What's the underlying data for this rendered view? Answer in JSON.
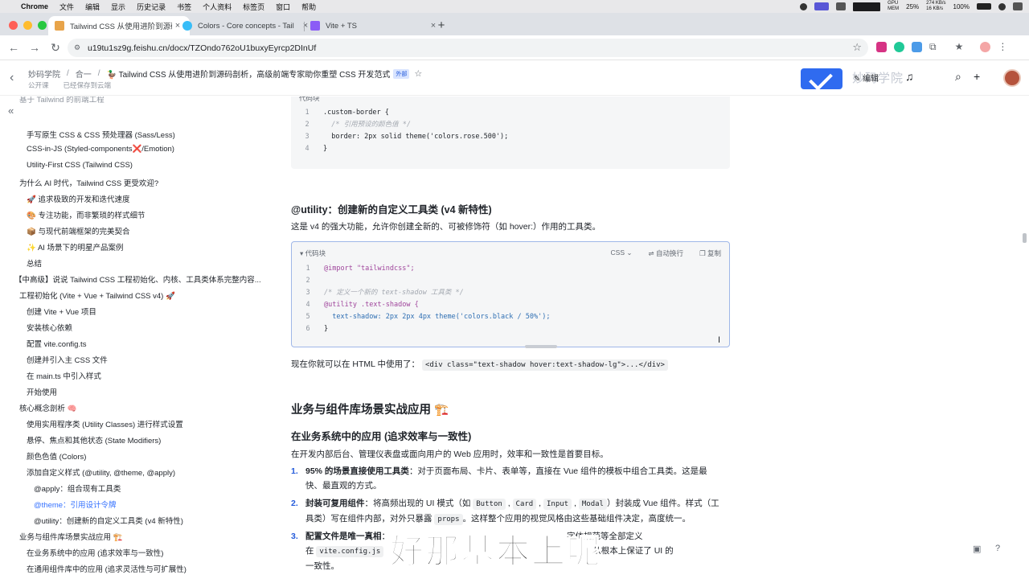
{
  "menubar": {
    "app": "Chrome",
    "items": [
      "文件",
      "编辑",
      "显示",
      "历史记录",
      "书签",
      "个人资料",
      "标签页",
      "窗口",
      "帮助"
    ],
    "stats": {
      "gpu": "GPU",
      "mem": "MEM",
      "cpu_val": "25%",
      "net_up": "274 KB/s",
      "net_down": "16 KB/s",
      "battery": "100%"
    }
  },
  "tabs": [
    {
      "title": "Tailwind CSS 从使用进阶到源码",
      "active": true,
      "color": "#e8a44a"
    },
    {
      "title": "Colors - Core concepts - Tail",
      "active": false,
      "color": "#38bdf8"
    },
    {
      "title": "Vite + TS",
      "active": false,
      "color": "#8b5cf6"
    }
  ],
  "address": {
    "url": "u19tu1sz9g.feishu.cn/docx/TZOndo762oU1buxyEyrcp2DInUf"
  },
  "doc_header": {
    "crumb_root": "妙码学院",
    "crumb_mid": "合一",
    "title": "🦆 Tailwind CSS 从使用进阶到源码剖析，高级前端专家助你重塑 CSS 开发范式",
    "tag": "外部",
    "visibility": "公开课",
    "save_status": "已经保存到云端",
    "edit_label": "编辑",
    "watermark": "妙码学院"
  },
  "sidebar": {
    "cut_top": "基于 Tailwind 的前端工程",
    "items": [
      {
        "text": "手写原生 CSS & CSS 预处理器 (Sass/Less)",
        "level": 2
      },
      {
        "text": "CSS-in-JS (Styled-components❌/Emotion)",
        "level": 2
      },
      {
        "text": "Utility-First CSS (Tailwind CSS)",
        "level": 2
      },
      {
        "text": "为什么 AI 时代，Tailwind CSS 更受欢迎?",
        "level": 1
      },
      {
        "text": "🚀 追求极致的开发和迭代速度",
        "level": 2
      },
      {
        "text": "🎨 专注功能，而非繁琐的样式细节",
        "level": 2
      },
      {
        "text": "📦 与现代前端框架的完美契合",
        "level": 2
      },
      {
        "text": "✨ AI 场景下的明星产品案例",
        "level": 2
      },
      {
        "text": "总结",
        "level": 2
      },
      {
        "text": "【中高级】说说 Tailwind CSS 工程初始化、内核、工具类体系完整内容...",
        "level": 0
      },
      {
        "text": "工程初始化 (Vite + Vue + Tailwind CSS v4) 🚀",
        "level": 1
      },
      {
        "text": "创建 Vite + Vue 项目",
        "level": 2
      },
      {
        "text": "安装核心依赖",
        "level": 2
      },
      {
        "text": "配置 vite.config.ts",
        "level": 2
      },
      {
        "text": "创建并引入主 CSS 文件",
        "level": 2
      },
      {
        "text": "在 main.ts 中引入样式",
        "level": 2
      },
      {
        "text": "开始使用",
        "level": 2
      },
      {
        "text": "核心概念剖析 🧠",
        "level": 1
      },
      {
        "text": "使用实用程序类 (Utility Classes) 进行样式设置",
        "level": 2
      },
      {
        "text": "悬停、焦点和其他状态 (State Modifiers)",
        "level": 2
      },
      {
        "text": "颜色色值 (Colors)",
        "level": 2
      },
      {
        "text": "添加自定义样式 (@utility, @theme, @apply)",
        "level": 2
      },
      {
        "text": "@apply：组合现有工具类",
        "level": 3
      },
      {
        "text": "@theme：引用设计令牌",
        "level": 3,
        "active": true
      },
      {
        "text": "@utility：创建新的自定义工具类 (v4 新特性)",
        "level": 3
      },
      {
        "text": "业务与组件库场景实战应用 🏗️",
        "level": 1
      },
      {
        "text": "在业务系统中的应用 (追求效率与一致性)",
        "level": 2
      },
      {
        "text": "在通用组件库中的应用 (追求灵活性与可扩展性)",
        "level": 2
      }
    ]
  },
  "code_top": {
    "label": "代码块",
    "lines": [
      {
        "n": "1",
        "text": ".custom-border {"
      },
      {
        "n": "2",
        "text": "  /* 引用预设的颜色值 */"
      },
      {
        "n": "3",
        "text": "  border: 2px solid theme('colors.rose.500');"
      },
      {
        "n": "4",
        "text": "}"
      }
    ]
  },
  "section_utility": {
    "heading": "@utility：创建新的自定义工具类 (v4 新特性)",
    "desc": "这是 v4 的强大功能，允许你创建全新的、可被修饰符（如 hover:）作用的工具类。"
  },
  "code_mid": {
    "label": "代码块",
    "lang": "CSS",
    "wrap": "自动换行",
    "copy": "复制",
    "l1": "@import \"tailwindcss\";",
    "l3": "/* 定义一个新的 text-shadow 工具类 */",
    "l4": "@utility .text-shadow {",
    "l5": "  text-shadow: 2px 2px 4px theme('colors.black / 50%');",
    "l6": "}"
  },
  "usage": {
    "prefix": "现在你就可以在 HTML 中使用了：",
    "code": "<div class=\"text-shadow hover:text-shadow-lg\">...</div>"
  },
  "section_business": {
    "heading": "业务与组件库场景实战应用 🏗️",
    "sub_heading": "在业务系统中的应用 (追求效率与一致性)",
    "desc": "在开发内部后台、管理仪表盘或面向用户的 Web 应用时，效率和一致性是首要目标。",
    "li1_num": "1.",
    "li1_bold": "95% 的场景直接使用工具类",
    "li1_text": "：对于页面布局、卡片、表单等，直接在 Vue 组件的模板中组合工具类。这是最",
    "li1_cont": "快、最直观的方式。",
    "li2_num": "2.",
    "li2_bold": "封装可复用组件",
    "li2_text_a": "：将高频出现的 UI 模式（如 ",
    "li2_codes": [
      "Button",
      "Card",
      "Input",
      "Modal"
    ],
    "li2_text_b": "）封装成 Vue 组件。样式（工",
    "li2_cont_a": "具类）写在组件内部，对外只暴露 ",
    "li2_cont_code": "props",
    "li2_cont_b": "。这样整个应用的视觉风格由这些基础组件决定，高度统一。",
    "li3_num": "3.",
    "li3_bold": "配置文件是唯一真相",
    "li3_text": "：",
    "li3_tail": "字体规范等全部定义",
    "li3_cont_a": "在 ",
    "li3_cont_code": "vite.config.js",
    "li3_cont_b": "从根本上保证了 UI 的",
    "li3_cont2": "一致性。"
  },
  "subtitle": "好那基本上呢"
}
